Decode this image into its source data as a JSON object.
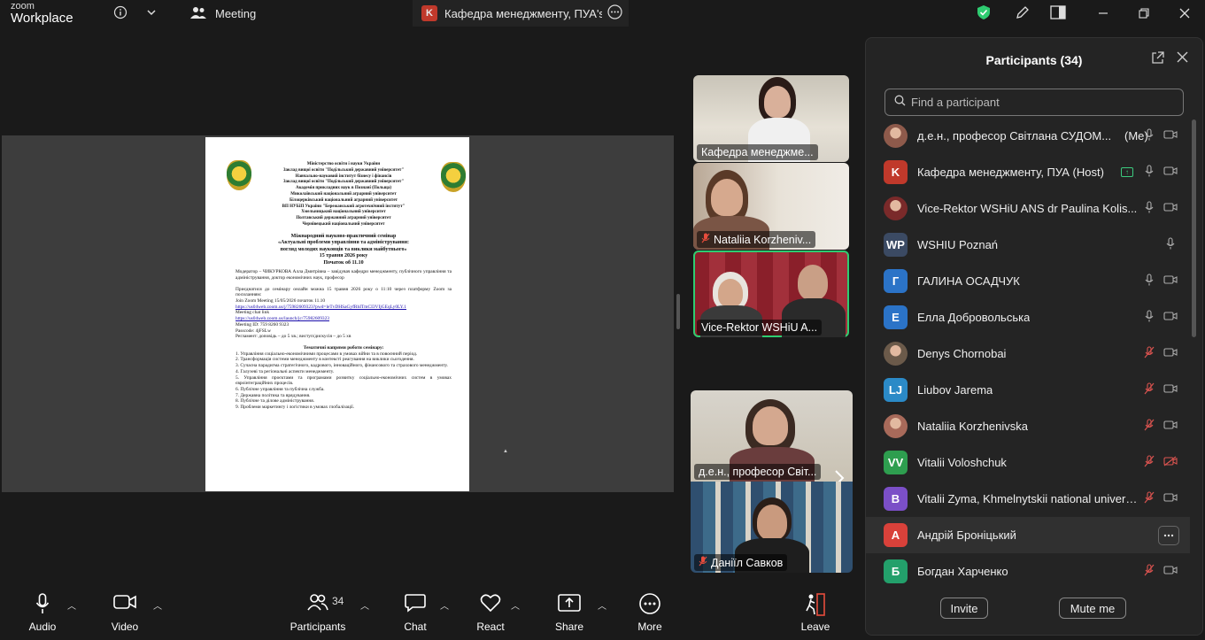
{
  "topbar": {
    "logo_zoom": "zoom",
    "logo_workplace": "Workplace",
    "tab_meeting": "Meeting",
    "tab_active": "Кафедра менеджменту, ПУА's sc",
    "tab_active_letter": "K"
  },
  "document": {
    "header_lines": [
      "Міністерство освіти і науки України",
      "Заклад вищої освіти \"Подільський державний університет\"",
      "Навчально-науковий інститут бізнесу і фінансів",
      "Заклад вищої освіти \"Подільський державний університет\"",
      "Академія прикладних наук в Познані (Польща)",
      "Миколаївський національний аграрний університет",
      "Білоцерківський національний аграрний університет",
      "ВП НУБіП України \"Бережанський агротехнічний інститут\"",
      "Хмельницький національний університет",
      "Полтавський державний аграрний університет",
      "Чернівецький національний університет"
    ],
    "title_lines": [
      "Міжнародний науково-практичний семінар",
      "«Актуальні проблеми управління та адміністрування:",
      "погляд молодих науковців та виклики майбутнього»",
      "15 травня 2026 року",
      "Початок об 11.10"
    ],
    "moderator": "Модератор – ЧИКУРКОВА Алла Дмитрівна – завідувач кафедри менеджменту, публічного управління та адміністрування, доктор економічних наук, професор",
    "invite": "Приєднатися до семінару онлайн можна 15 травня 2026 року о 11:10 через платформу Zoom за посиланням:",
    "join_line": "Join Zoom Meeting 15/05/2026 початок 11.10",
    "join_link": "https://us04web.zoom.us/j/75982609323?pwd=leTvDHSaGyfRhITmCI3VIjGEqLy0LY.1",
    "chat_label": "Meeting chat link",
    "chat_link": "https://us04web.zoom.us/launch/jc/75982609323",
    "meeting_id": "Meeting ID: 759 8260 9323",
    "passcode": "Passcode: 4jFSLw",
    "reglament": "Регламент: доповідь – до 5 хв.; виступ/дискусія – до 5 хв",
    "topics_title": "Тематичні напрями роботи семінару:",
    "topics": [
      "1. Управління соціально-економічними процесами в умовах війни та в повоєнний період.",
      "2. Трансформація системи менеджменту в контексті реагування на виклики сьогодення.",
      "3. Сучасна парадигма стратегічного, кадрового, інноваційного, фінансового та страхового менеджменту.",
      "4. Галузеві та регіональні аспекти менеджменту.",
      "5. Управління проєктами та програмами розвитку соціально-економічних систем в умовах євроінтеграційних процесів.",
      "6. Публічне управління та публічна служба.",
      "7. Державна політика та врядування.",
      "8. Публічне та ділове адміністрування.",
      "9. Проблеми маркетингу і логістики в умовах глобалізації."
    ]
  },
  "tiles": [
    {
      "name": "Кафедра менеджме..."
    },
    {
      "name": "Nataliia Korzheniv..."
    },
    {
      "name": "Vice-Rektor WSHiU A..."
    },
    {
      "name": "д.е.н., професор Світ..."
    },
    {
      "name": "Даніїл Савков"
    }
  ],
  "panel": {
    "title": "Participants (34)",
    "search_placeholder": "Find a participant",
    "invite_label": "Invite",
    "mute_label": "Mute me",
    "participants": [
      {
        "name": "д.е.н., професор Світлана СУДОМ...",
        "tag": "(Me)",
        "avatar": "",
        "color": "#8e5a4b"
      },
      {
        "name": "Кафедра менеджменту, ПУА (Host)",
        "tag": "",
        "avatar": "K",
        "color": "#c0392b"
      },
      {
        "name": "Vice-Rektor WSHiU ANS dr Paulina Kolis...",
        "tag": "",
        "avatar": "",
        "color": "#7a2a2a"
      },
      {
        "name": "WSHIU Poznań",
        "tag": "",
        "avatar": "WP",
        "color": "#3b4a63"
      },
      {
        "name": "ГАЛИНА ОСАДЧУК",
        "tag": "",
        "avatar": "Г",
        "color": "#2b73c7"
      },
      {
        "name": "Елла Добровольська",
        "tag": "",
        "avatar": "Е",
        "color": "#2b73c7"
      },
      {
        "name": "Denys Chornobai",
        "tag": "",
        "avatar": "",
        "color": "#6b5a4a"
      },
      {
        "name": "Liubov Jarema",
        "tag": "",
        "avatar": "LJ",
        "color": "#2b8ac7"
      },
      {
        "name": "Nataliia Korzhenivska",
        "tag": "",
        "avatar": "",
        "color": "#a86a5a"
      },
      {
        "name": "Vitalii Voloshchuk",
        "tag": "",
        "avatar": "VV",
        "color": "#2e9e4f"
      },
      {
        "name": "Vitalii Zyma, Khmelnytskii national univers...",
        "tag": "",
        "avatar": "B",
        "color": "#7b4fc7"
      },
      {
        "name": "Андрій Броніцький",
        "tag": "",
        "avatar": "А",
        "color": "#d9413a"
      },
      {
        "name": "Богдан Харченко",
        "tag": "",
        "avatar": "Б",
        "color": "#23a06b"
      }
    ]
  },
  "toolbar": {
    "audio": "Audio",
    "video": "Video",
    "participants": "Participants",
    "participants_count": "34",
    "chat": "Chat",
    "react": "React",
    "share": "Share",
    "more": "More",
    "leave": "Leave"
  },
  "colors": {
    "accent_green": "#2ecc71",
    "mute_red": "#d9534f",
    "background": "#1a1a1a",
    "panel": "#242424"
  }
}
